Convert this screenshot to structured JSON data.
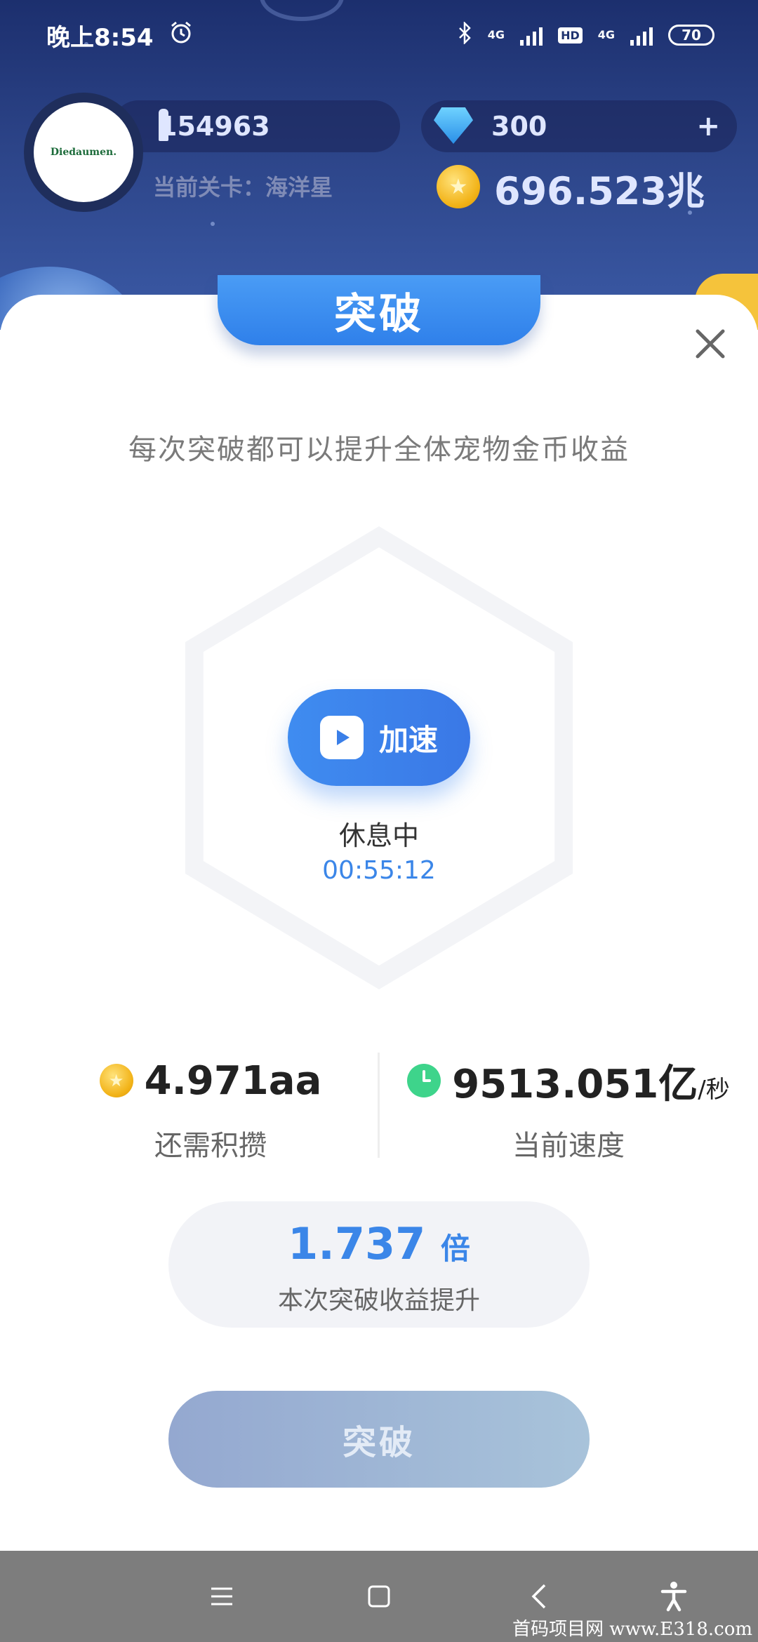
{
  "status_bar": {
    "time": "晚上8:54",
    "network_1": "4G",
    "hd": "HD",
    "network_2": "4G",
    "battery": "70"
  },
  "player": {
    "avatar_text": "Diedaumen.",
    "power": "154963",
    "level": "当前关卡：海洋星",
    "gems": "300",
    "gems_add": "+",
    "coins": "696.523兆"
  },
  "dialog": {
    "title": "突破",
    "subtitle": "每次突破都可以提升全体宠物金币收益",
    "speed_up_label": "加速",
    "status": "休息中",
    "timer": "00:55:12"
  },
  "stats": {
    "needed_value": "4.971aa",
    "needed_label": "还需积攒",
    "speed_value": "9513.051亿",
    "speed_unit": "/秒",
    "speed_label": "当前速度"
  },
  "multiplier": {
    "value": "1.737",
    "unit": "倍",
    "label": "本次突破收益提升"
  },
  "breakthrough_button": "突破",
  "watermark": "首码项目网 www.E318.com",
  "colors": {
    "accent": "#3b86e8",
    "top_background": "#2c4488",
    "button_disabled": "#a0b6d6",
    "nav_bar": "#7d7d7d"
  },
  "icons": [
    "alarm-icon",
    "bluetooth-icon",
    "signal-icon",
    "sword-icon",
    "gem-icon",
    "coin-icon",
    "close-icon",
    "play-icon",
    "clock-icon",
    "menu-icon",
    "home-icon",
    "back-icon",
    "accessibility-icon"
  ]
}
